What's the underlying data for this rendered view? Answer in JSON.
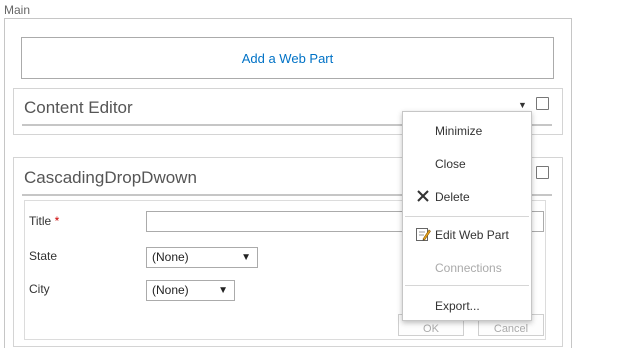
{
  "zone": {
    "label": "Main"
  },
  "add_webpart": {
    "label": "Add a Web Part"
  },
  "webparts": [
    {
      "title": "Content Editor"
    },
    {
      "title": "CascadingDropDwown"
    }
  ],
  "form": {
    "title_label": "Title",
    "required_mark": "*",
    "state_label": "State",
    "state_value": "(None)",
    "city_label": "City",
    "city_value": "(None)",
    "ok_label": "OK",
    "cancel_label": "Cancel"
  },
  "menu_arrow": "▼",
  "context_menu": {
    "items": [
      {
        "label": "Minimize",
        "icon": "none"
      },
      {
        "label": "Close",
        "icon": "none"
      },
      {
        "label": "Delete",
        "icon": "delete-x-icon"
      },
      {
        "label": "Edit Web Part",
        "icon": "edit-pencil-icon"
      },
      {
        "label": "Connections",
        "icon": "none",
        "disabled": true
      },
      {
        "label": "Export...",
        "icon": "none"
      }
    ]
  },
  "colors": {
    "link_blue": "#0072c6",
    "required_red": "#cc0000",
    "border_grey": "#c6c6c6"
  }
}
